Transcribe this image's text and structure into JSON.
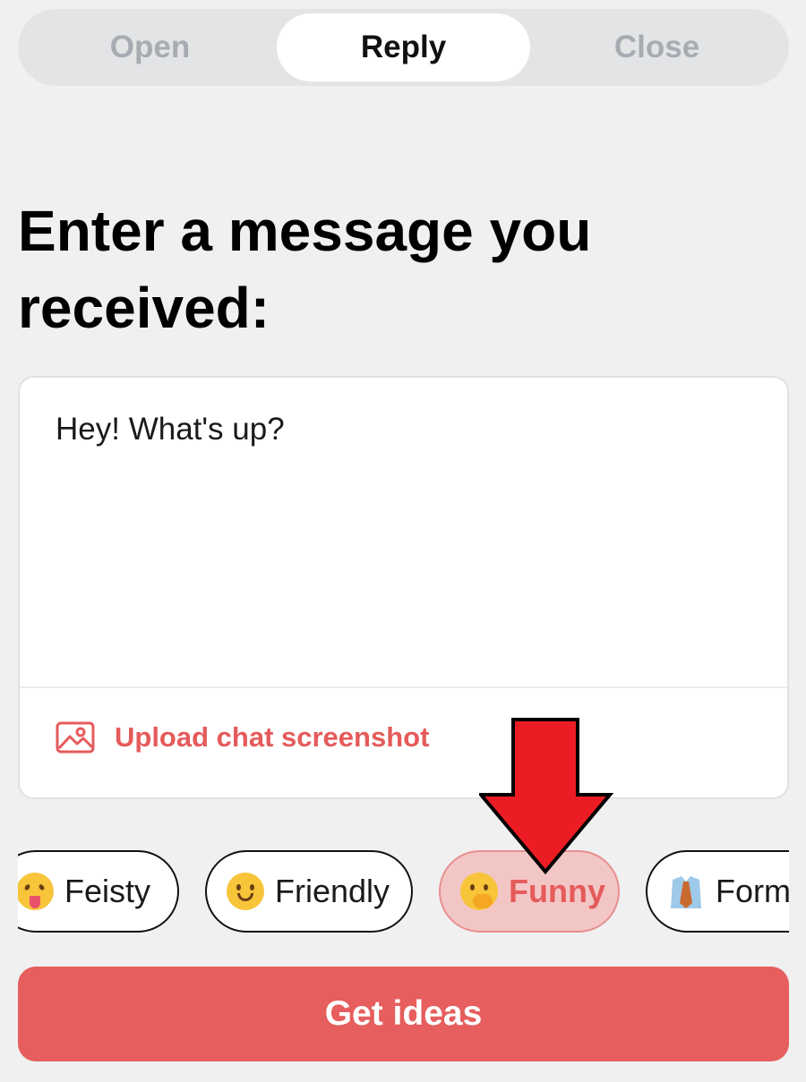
{
  "tabs": [
    {
      "label": "Open",
      "active": false
    },
    {
      "label": "Reply",
      "active": true
    },
    {
      "label": "Close",
      "active": false
    }
  ],
  "heading": "Enter a message you received:",
  "message_input": {
    "value": "Hey! What's up?"
  },
  "upload": {
    "label": "Upload chat screenshot",
    "icon": "image-icon"
  },
  "tones": [
    {
      "label": "Feisty",
      "emoji": "squinting-tongue-face-icon",
      "selected": false
    },
    {
      "label": "Friendly",
      "emoji": "smiling-face-icon",
      "selected": false
    },
    {
      "label": "Funny",
      "emoji": "hand-over-mouth-face-icon",
      "selected": true
    },
    {
      "label": "Form",
      "emoji": "necktie-shirt-icon",
      "selected": false
    }
  ],
  "cta": {
    "label": "Get ideas"
  },
  "colors": {
    "accent": "#e65e5d",
    "selected_chip_bg": "#f3c6c6",
    "annotation_arrow": "#ec1c24"
  }
}
